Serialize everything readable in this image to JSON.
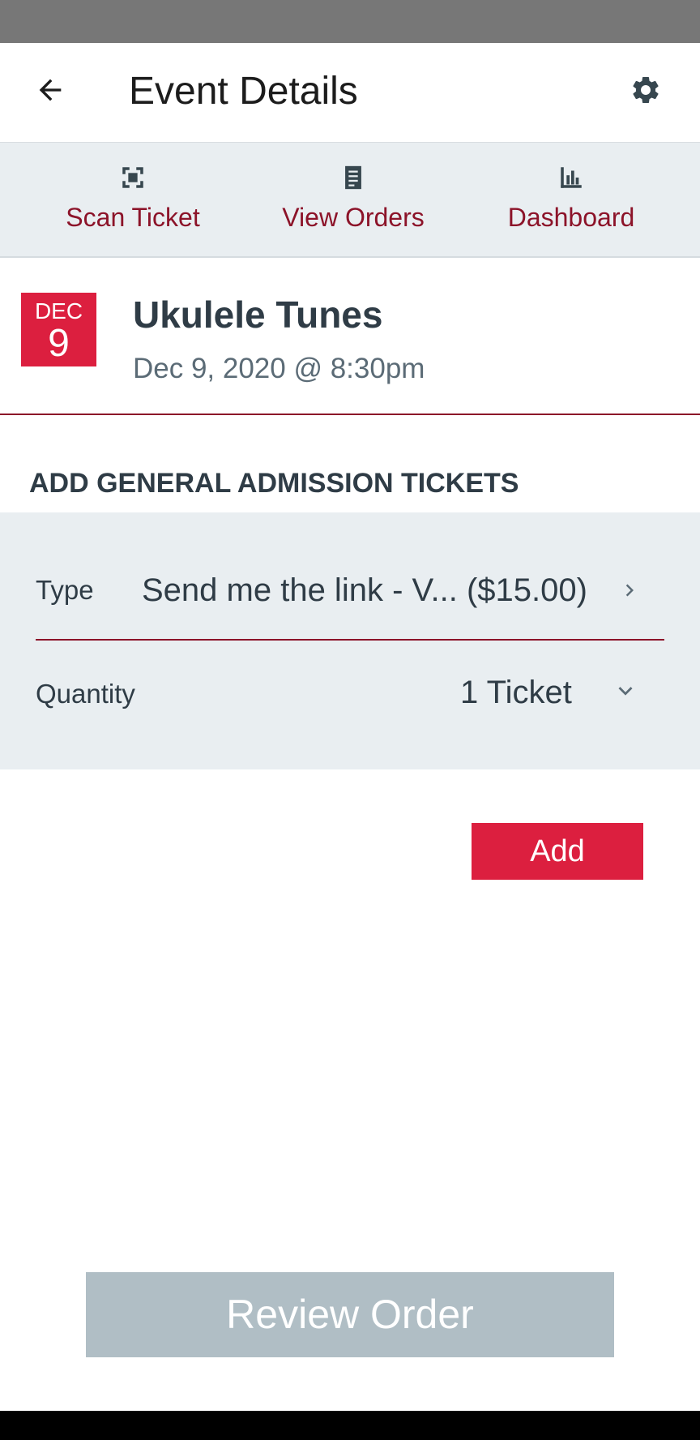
{
  "app_bar": {
    "title": "Event Details",
    "back_icon": "arrow-left-icon",
    "settings_icon": "gear-icon"
  },
  "tabs": [
    {
      "label": "Scan Ticket",
      "icon": "scan-icon"
    },
    {
      "label": "View Orders",
      "icon": "document-icon"
    },
    {
      "label": "Dashboard",
      "icon": "bar-chart-icon"
    }
  ],
  "event": {
    "month": "DEC",
    "day": "9",
    "title": "Ukulele Tunes",
    "date_time": "Dec 9, 2020 @ 8:30pm"
  },
  "tickets_section": {
    "heading": "ADD GENERAL ADMISSION TICKETS",
    "type_label": "Type",
    "type_value": "Send me the link - V... ($15.00)",
    "quantity_label": "Quantity",
    "quantity_value": "1 Ticket",
    "add_label": "Add"
  },
  "footer": {
    "review_label": "Review Order"
  },
  "colors": {
    "accent": "#8c1329",
    "primary_button": "#dc1f3f",
    "disabled_button": "#b0bec5",
    "panel_background": "#e9eef1",
    "text_dark": "#2f3c46"
  }
}
